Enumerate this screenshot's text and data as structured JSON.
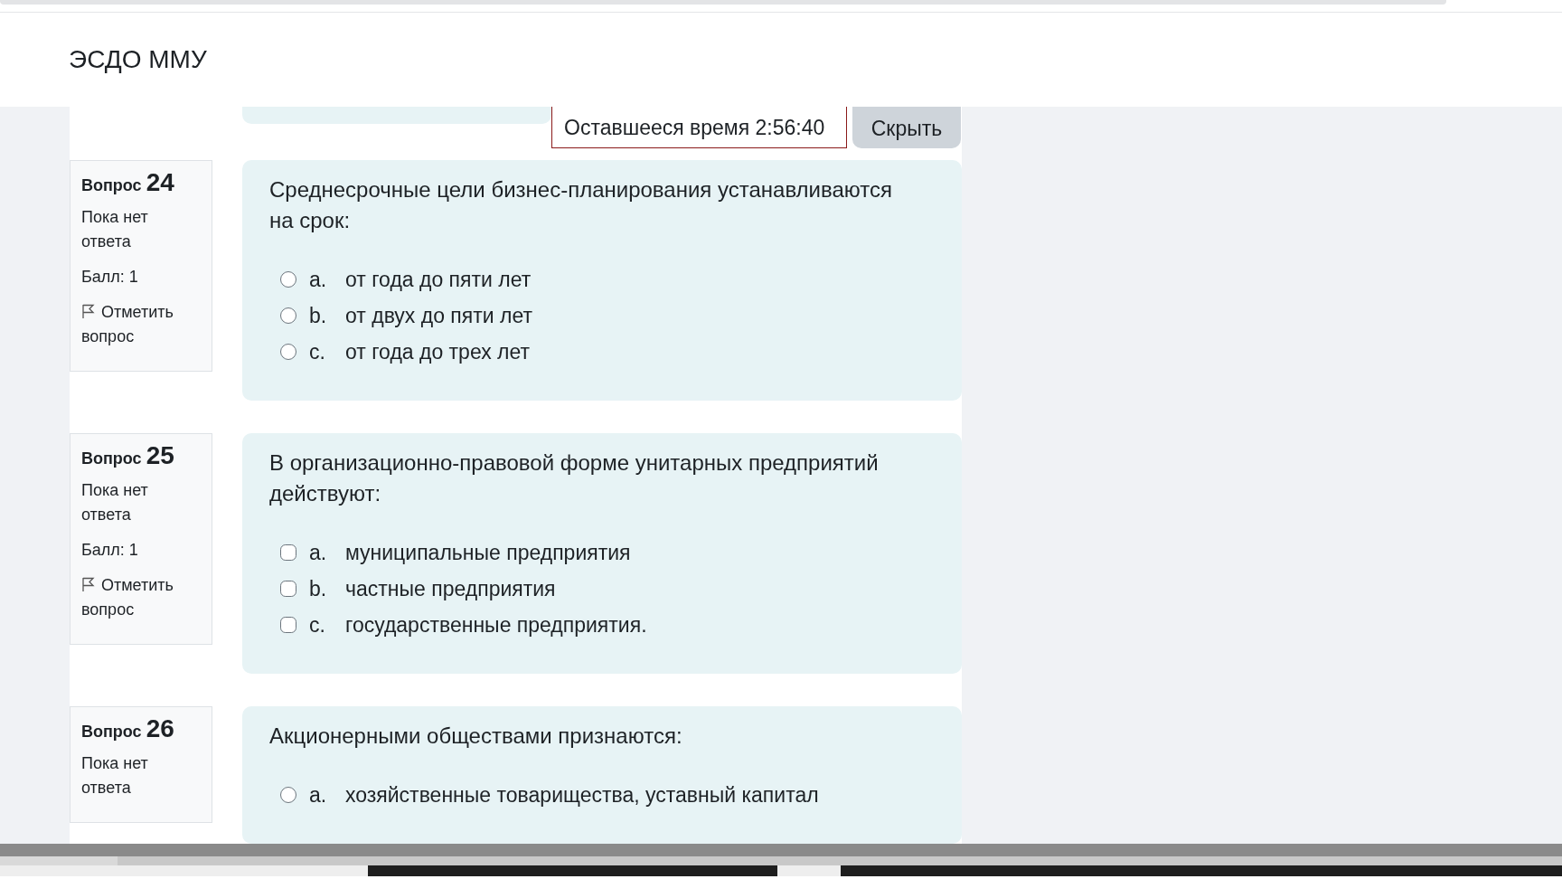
{
  "site_title": "ЭСДО ММУ",
  "timer": {
    "label": "Оставшееся время 2:56:40"
  },
  "hide_button": "Скрыть",
  "questions": [
    {
      "label": "Вопрос",
      "number": "24",
      "status": "Пока нет ответа",
      "score": "Балл: 1",
      "flag_link": "Отметить вопрос",
      "text": "Среднесрочные цели бизнес-планирования устанавливаются на срок:",
      "kind": "radio",
      "options": [
        {
          "letter": "a.",
          "text": "от года до пяти лет",
          "selected": false
        },
        {
          "letter": "b.",
          "text": "от двух до пяти лет",
          "selected": false
        },
        {
          "letter": "c.",
          "text": "от года до трех лет",
          "selected": false
        }
      ]
    },
    {
      "label": "Вопрос",
      "number": "25",
      "status": "Пока нет ответа",
      "score": "Балл: 1",
      "flag_link": "Отметить вопрос",
      "text": "В организационно-правовой форме унитарных предприятий действуют:",
      "kind": "checkbox",
      "options": [
        {
          "letter": "a.",
          "text": "муниципальные предприятия",
          "checked": false
        },
        {
          "letter": "b.",
          "text": "частные предприятия",
          "checked": false
        },
        {
          "letter": "c.",
          "text": "государственные предприятия.",
          "checked": false
        }
      ]
    },
    {
      "label": "Вопрос",
      "number": "26",
      "status": "Пока нет ответа",
      "text": "Акционерными обществами признаются:",
      "kind": "radio",
      "options": [
        {
          "letter": "a.",
          "text": "хозяйственные товарищества, уставный капитал",
          "selected": false
        }
      ]
    }
  ]
}
